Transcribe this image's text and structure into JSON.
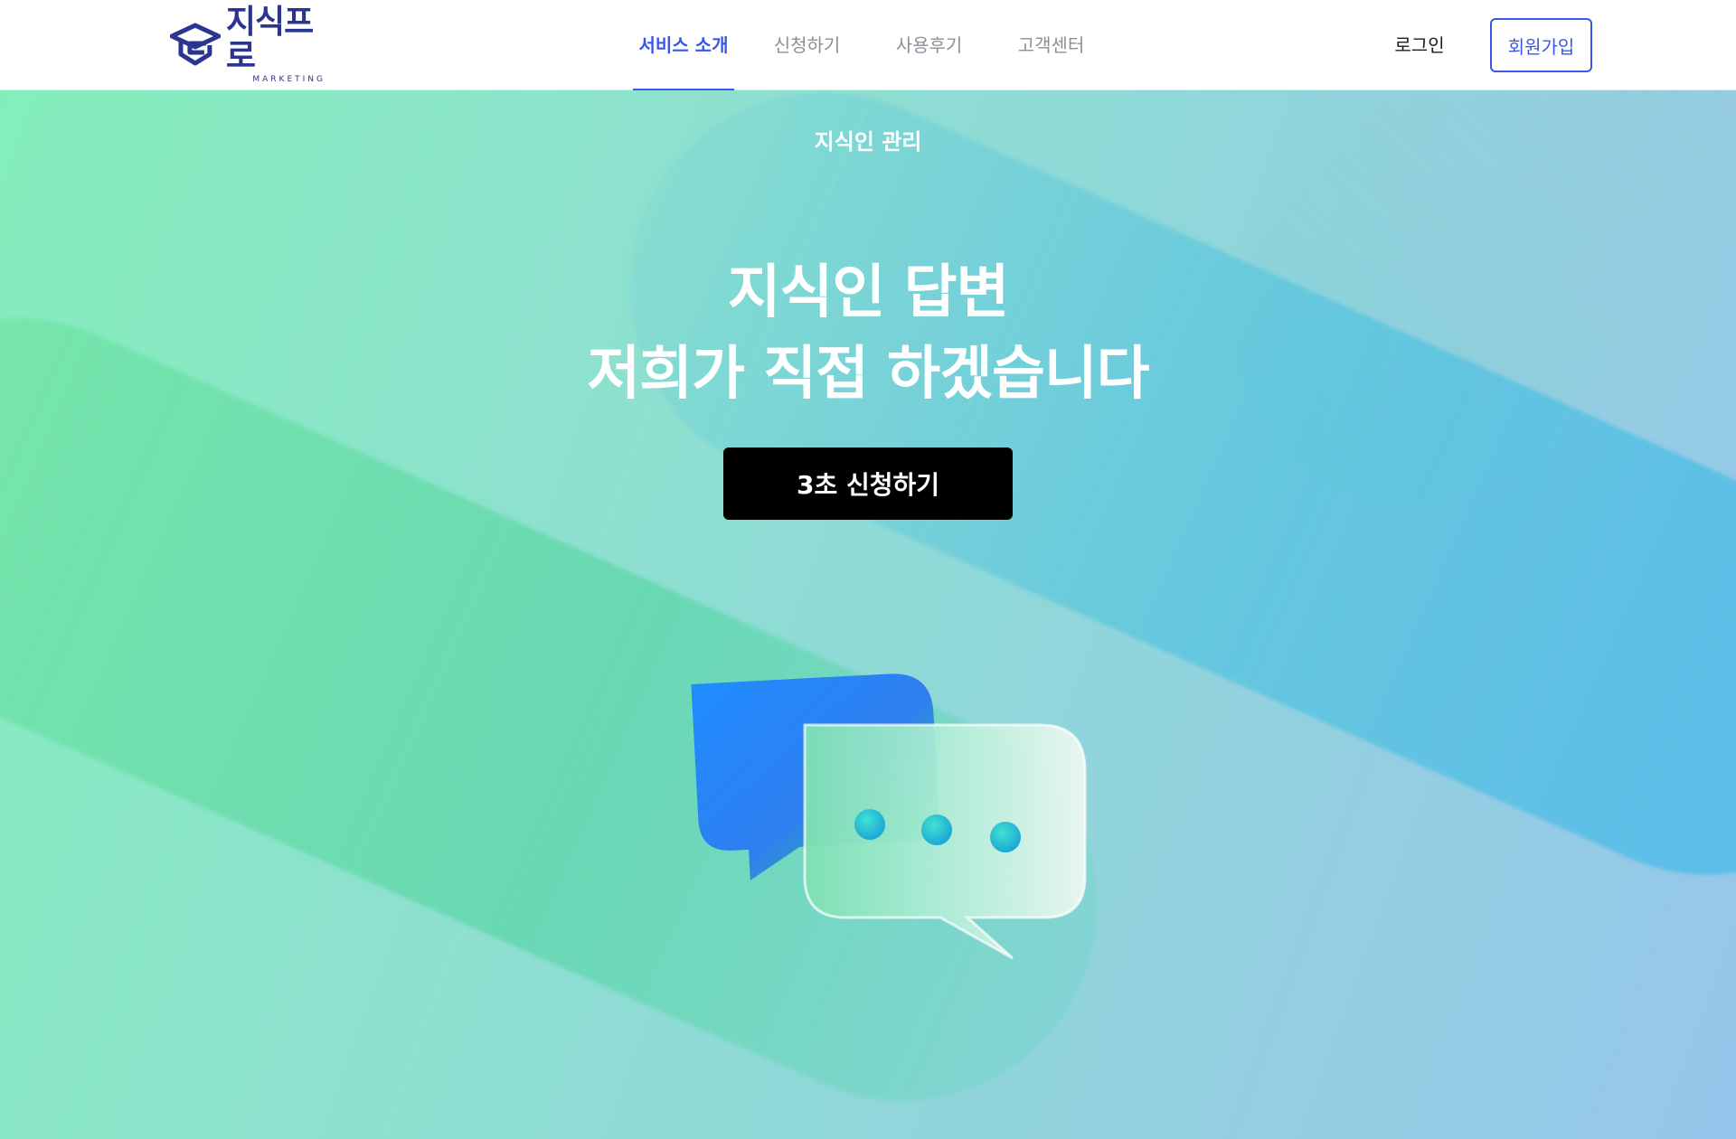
{
  "header": {
    "logo": {
      "title": "지식프로",
      "subtitle": "MARKETING",
      "color": "#2a3491"
    },
    "nav": [
      {
        "label": "서비스 소개",
        "active": true
      },
      {
        "label": "신청하기",
        "active": false
      },
      {
        "label": "사용후기",
        "active": false
      },
      {
        "label": "고객센터",
        "active": false
      }
    ],
    "login_label": "로그인",
    "signup_label": "회원가입",
    "accent_color": "#3a57e8"
  },
  "hero": {
    "eyebrow": "지식인 관리",
    "headline_line1": "지식인 답변",
    "headline_line2": "저희가 직접 하겠습니다",
    "cta_label": "3초 신청하기",
    "illustration_icon": "chat-bubbles-icon"
  }
}
